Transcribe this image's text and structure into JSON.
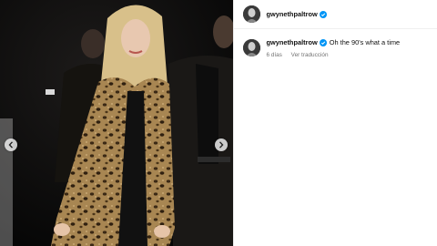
{
  "post": {
    "username": "gwynethpaltrow",
    "caption": "Oh the 90's what a time",
    "age": "6 días",
    "translate_label": "Ver traducción",
    "accent_color": "#0095f6"
  },
  "media": {
    "prev_icon": "chevron-left-icon",
    "next_icon": "chevron-right-icon"
  }
}
